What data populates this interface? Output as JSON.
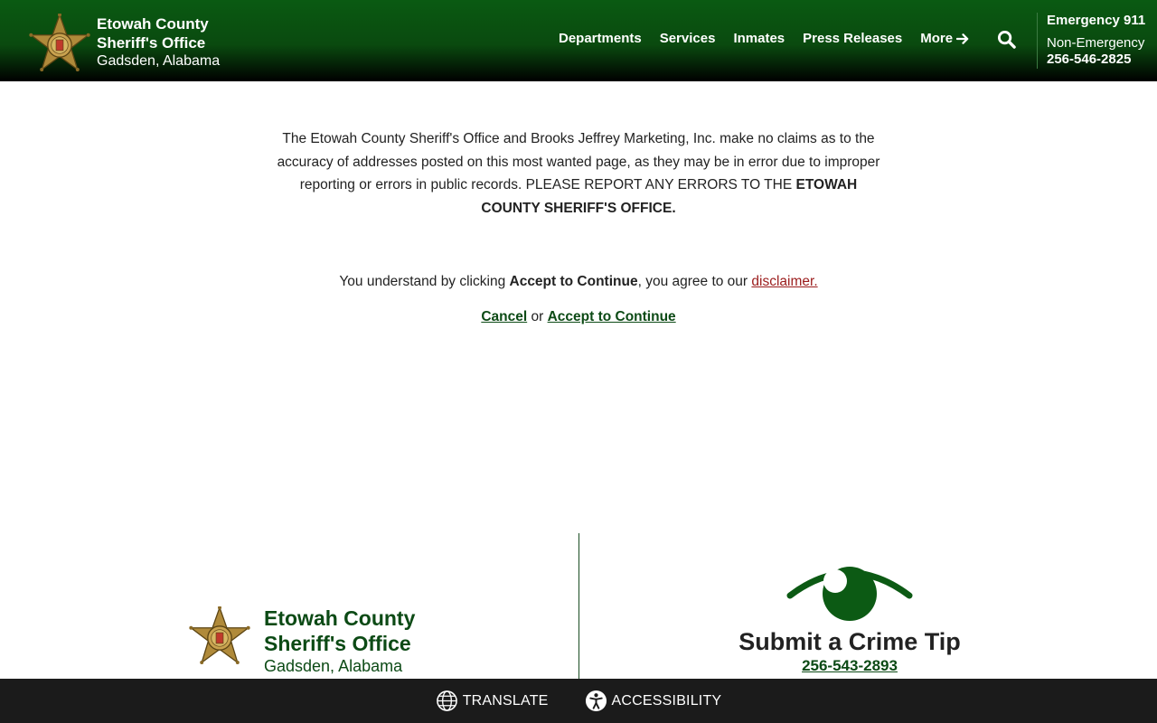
{
  "header": {
    "title_line1": "Etowah County",
    "title_line2": "Sheriff's Office",
    "subtitle": "Gadsden, Alabama",
    "nav": {
      "departments": "Departments",
      "services": "Services",
      "inmates": "Inmates",
      "press": "Press Releases",
      "more": "More"
    },
    "contact": {
      "emergency": "Emergency 911",
      "non_emergency_label": "Non-Emergency",
      "non_emergency_phone": "256-546-2825"
    }
  },
  "main": {
    "disclaimer_part1": "The Etowah County Sheriff's Office and Brooks Jeffrey Marketing, Inc. make no claims as to the accuracy of addresses posted on this most wanted page, as they may be in error due to improper reporting or errors in public records. PLEASE REPORT ANY ERRORS TO THE ",
    "disclaimer_bold": "ETOWAH COUNTY SHERIFF'S OFFICE.",
    "agree_prefix": "You understand by clicking ",
    "agree_bold": "Accept to Continue",
    "agree_middle": ", you agree to our ",
    "agree_link": "disclaimer.",
    "cancel": "Cancel",
    "or": " or ",
    "accept": "Accept to Continue"
  },
  "footer": {
    "title_line1": "Etowah County",
    "title_line2": "Sheriff's Office",
    "subtitle": "Gadsden, Alabama",
    "tip_title": "Submit a Crime Tip",
    "tip_phone": "256-543-2893"
  },
  "bottom_bar": {
    "translate": "TRANSLATE",
    "accessibility": "ACCESSIBILITY"
  },
  "icons": [
    "sheriff-badge-icon",
    "arrow-right-icon",
    "search-icon",
    "eye-icon",
    "globe-icon",
    "accessibility-icon"
  ],
  "colors": {
    "header_green": "#0a5a12",
    "link_green": "#0c4a15",
    "disclaimer_red": "#9b1c1c",
    "bottom_bar": "#1b1b1b"
  }
}
